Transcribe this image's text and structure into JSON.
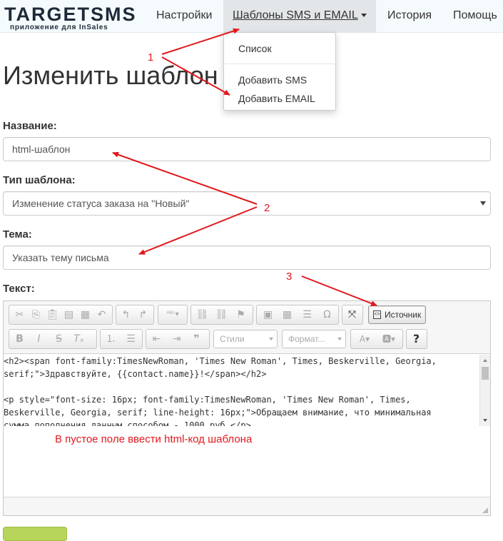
{
  "navbar": {
    "logo_text": "TARGETSMS",
    "logo_sub": "приложение для InSales",
    "items": [
      {
        "label": "Настройки"
      },
      {
        "label": "Шаблоны SMS и EMAIL"
      },
      {
        "label": "История"
      },
      {
        "label": "Помощь"
      }
    ]
  },
  "dropdown": {
    "items": [
      "Список",
      "Добавить SMS",
      "Добавить EMAIL"
    ]
  },
  "page": {
    "title": "Изменить шаблон"
  },
  "form": {
    "name_label": "Название:",
    "name_value": "html-шаблон",
    "type_label": "Тип шаблона:",
    "type_value": "Изменение статуса заказа на \"Новый\"",
    "subject_label": "Тема:",
    "subject_value": "Указать тему письма",
    "text_label": "Текст:"
  },
  "editor": {
    "styles_combo": "Стили",
    "format_combo": "Формат...",
    "source_button": "Источник",
    "code_lines": [
      "<h2><span font-family:TimesNewRoman, 'Times New Roman', Times, Beskerville, Georgia,",
      "serif;\">Здравствуйте, {{contact.name}}!</span></h2>",
      "",
      "<p style=\"font-size: 16px; font-family:TimesNewRoman, 'Times New Roman', Times,",
      "Beskerville, Georgia, serif; line-height: 16px;\">Обращаем внимание, что минимальная",
      "сумма пополнения данным способом - 1000 руб.</p>"
    ]
  },
  "annotations": {
    "n1": "1",
    "n2": "2",
    "n3": "3",
    "hint": "В пустое поле ввести html-код шаблона",
    "color": "#e0191e"
  },
  "colors": {
    "navbar_bg": "#f5fbfd",
    "active_nav_bg": "#e2e6e8",
    "save_button": "#b7d55a"
  }
}
